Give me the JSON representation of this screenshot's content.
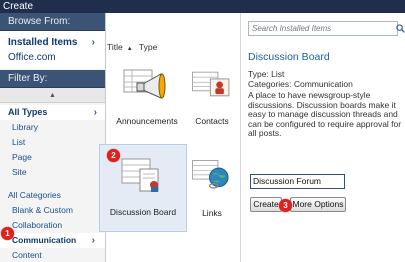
{
  "window": {
    "title": "Create"
  },
  "sidebar": {
    "browse_header": "Browse From:",
    "browse_items": [
      {
        "label": "Installed Items",
        "selected": true
      },
      {
        "label": "Office.com",
        "selected": false
      }
    ],
    "filter_header": "Filter By:",
    "scroll_up_glyph": "▲",
    "type_header": "All Types",
    "types": [
      "Library",
      "List",
      "Page",
      "Site"
    ],
    "categories_header": "All Categories",
    "categories": [
      "Blank & Custom",
      "Collaboration",
      "Communication",
      "Content"
    ],
    "selected_category": "Communication",
    "chevron": "›"
  },
  "main": {
    "sort": {
      "title_label": "Title",
      "arrow": "▲",
      "type_label": "Type"
    },
    "tiles": [
      {
        "label": "Announcements",
        "icon": "announcements-icon"
      },
      {
        "label": "Contacts",
        "icon": "contacts-icon"
      },
      {
        "label": "Discussion Board",
        "icon": "discussion-board-icon",
        "selected": true
      },
      {
        "label": "Links",
        "icon": "links-icon"
      }
    ]
  },
  "details": {
    "search_placeholder": "Search Installed Items",
    "title": "Discussion Board",
    "type_line": "Type: List",
    "categories_line": "Categories: Communication",
    "description": "A place to have newsgroup-style discussions.  Discussion boards make it easy to manage discussion threads and can be configured to require approval for all posts.",
    "name_value": "Discussion Forum",
    "create_label": "Create",
    "more_options_label": "More Options"
  },
  "markers": [
    "1",
    "2",
    "3"
  ],
  "colors": {
    "accent": "#1d5ea8",
    "header": "#3b5374",
    "titlebar": "#1f2e4d",
    "marker": "#e2211c"
  }
}
